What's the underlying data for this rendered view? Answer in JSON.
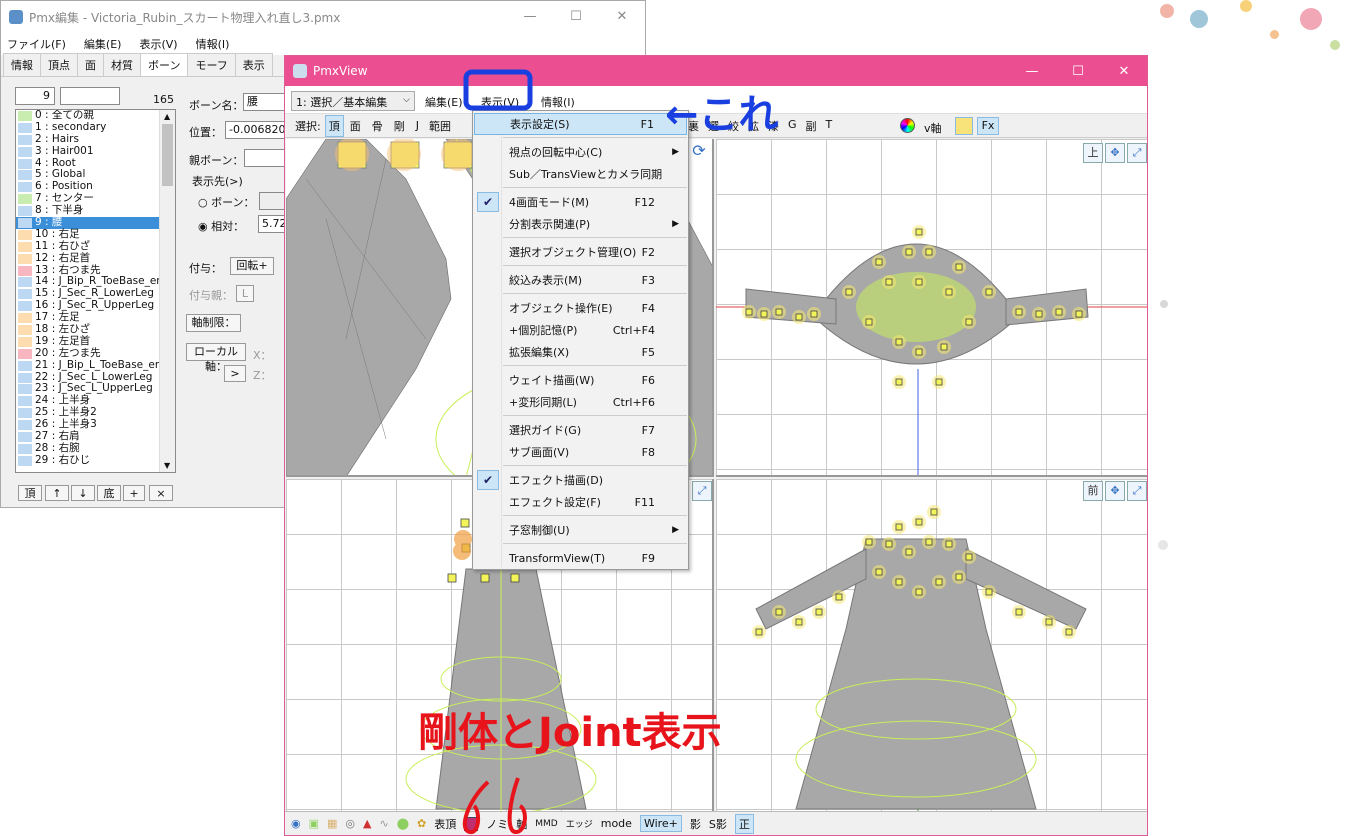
{
  "editor_window": {
    "title": "Pmx編集 - Victoria_Rubin_スカート物理入れ直し3.pmx",
    "menu": [
      "ファイル(F)",
      "編集(E)",
      "表示(V)",
      "情報(I)"
    ],
    "tabs": [
      "情報",
      "頂点",
      "面",
      "材質",
      "ボーン",
      "モーフ",
      "表示"
    ],
    "index_value": "9",
    "count": "165",
    "bone_name_label": "ボーン名：",
    "bone_name_value": "腰",
    "position_label": "位置：",
    "position_value": "-0.006820",
    "parent_label": "親ボーン：",
    "display_to_label": "表示先(>)",
    "radio_bone": "ボーン：",
    "radio_relative": "相対：",
    "relative_value": "5.722",
    "grant_label": "付与：",
    "grant_button": "回転+",
    "grant_parent_label": "付与親：",
    "grant_parent_button": "L",
    "axis_limit_label": "軸制限：",
    "local_axis_label": "ローカル軸：",
    "x_label": "X：",
    "z_label": "Z：",
    "arrow_button": ">",
    "bottom_buttons": [
      "頂",
      "↑",
      "↓",
      "底",
      "+",
      "×"
    ],
    "bones": [
      {
        "text": "0 : 全ての親",
        "color": "#c9ecb1"
      },
      {
        "text": "1 : secondary",
        "color": "#bcd8f2"
      },
      {
        "text": "2 : Hairs",
        "color": "#bcd8f2"
      },
      {
        "text": "3 : Hair001",
        "color": "#bcd8f2"
      },
      {
        "text": "4 : Root",
        "color": "#bcd8f2"
      },
      {
        "text": "5 : Global",
        "color": "#bcd8f2"
      },
      {
        "text": "6 : Position",
        "color": "#bcd8f2"
      },
      {
        "text": "7 : センター",
        "color": "#c9ecb1"
      },
      {
        "text": "8 : 下半身",
        "color": "#bcd8f2"
      },
      {
        "text": "9 : 腰",
        "color": "#bcd8f2"
      },
      {
        "text": "10 : 右足",
        "color": "#fddcb0"
      },
      {
        "text": "11 : 右ひざ",
        "color": "#fddcb0"
      },
      {
        "text": "12 : 右足首",
        "color": "#fddcb0"
      },
      {
        "text": "13 : 右つま先",
        "color": "#f7b6c0"
      },
      {
        "text": "14 : J_Bip_R_ToeBase_en",
        "color": "#bcd8f2"
      },
      {
        "text": "15 : J_Sec_R_LowerLeg",
        "color": "#bcd8f2"
      },
      {
        "text": "16 : J_Sec_R_UpperLeg",
        "color": "#bcd8f2"
      },
      {
        "text": "17 : 左足",
        "color": "#fddcb0"
      },
      {
        "text": "18 : 左ひざ",
        "color": "#fddcb0"
      },
      {
        "text": "19 : 左足首",
        "color": "#fddcb0"
      },
      {
        "text": "20 : 左つま先",
        "color": "#f7b6c0"
      },
      {
        "text": "21 : J_Bip_L_ToeBase_en",
        "color": "#bcd8f2"
      },
      {
        "text": "22 : J_Sec_L_LowerLeg",
        "color": "#bcd8f2"
      },
      {
        "text": "23 : J_Sec_L_UpperLeg",
        "color": "#bcd8f2"
      },
      {
        "text": "24 : 上半身",
        "color": "#bcd8f2"
      },
      {
        "text": "25 : 上半身2",
        "color": "#bcd8f2"
      },
      {
        "text": "26 : 上半身3",
        "color": "#bcd8f2"
      },
      {
        "text": "27 : 右肩",
        "color": "#bcd8f2"
      },
      {
        "text": "28 : 右腕",
        "color": "#bcd8f2"
      },
      {
        "text": "29 : 右ひじ",
        "color": "#bcd8f2"
      }
    ],
    "selected_bone_index": 9
  },
  "pmxview": {
    "title": "PmxView",
    "mode_select": "1: 選択／基本編集",
    "menu": [
      "編集(E)",
      "表示(V)",
      "情報(I)"
    ],
    "toolbar_select_label": "選択:",
    "toolbar_buttons": [
      "頂",
      "面",
      "骨",
      "剛",
      "J",
      "範囲"
    ],
    "toolbar_right": [
      "裏",
      "選",
      "絞",
      "拡",
      "漆",
      "G",
      "副",
      "T"
    ],
    "v_axis_label": "v軸",
    "fx_label": "Fx",
    "view_top_label": "上",
    "view_front_label": "前",
    "status": [
      "表頂",
      "ノミ",
      "軸",
      "MMD",
      "エッジ",
      "mode",
      "Wire+",
      "影",
      "S影",
      "正"
    ]
  },
  "view_menu": {
    "items": [
      {
        "label": "表示設定(S)",
        "shortcut": "F1",
        "highlight": true
      },
      {
        "label": "視点の回転中心(C)",
        "submenu": true
      },
      {
        "label": "Sub／TransViewとカメラ同期"
      },
      {
        "label": "4画面モード(M)",
        "shortcut": "F12",
        "checked": true
      },
      {
        "label": "分割表示関連(P)",
        "submenu": true
      },
      {
        "label": "選択オブジェクト管理(O)",
        "shortcut": "F2"
      },
      {
        "label": "絞込み表示(M)",
        "shortcut": "F3"
      },
      {
        "label": "オブジェクト操作(E)",
        "shortcut": "F4"
      },
      {
        "label": "+個別記憶(P)",
        "shortcut": "Ctrl+F4"
      },
      {
        "label": "拡張編集(X)",
        "shortcut": "F5"
      },
      {
        "label": "ウェイト描画(W)",
        "shortcut": "F6"
      },
      {
        "label": "+変形同期(L)",
        "shortcut": "Ctrl+F6"
      },
      {
        "label": "選択ガイド(G)",
        "shortcut": "F7"
      },
      {
        "label": "サブ画面(V)",
        "shortcut": "F8"
      },
      {
        "label": "エフェクト描画(D)",
        "checked": true
      },
      {
        "label": "エフェクト設定(F)",
        "shortcut": "F11"
      },
      {
        "label": "子窓制御(U)",
        "submenu": true
      },
      {
        "label": "TransformView(T)",
        "shortcut": "F9"
      }
    ]
  },
  "annotations": {
    "kore": "←これ",
    "rigid_joint": "剛体とJoint表示"
  },
  "colors": {
    "pmxview_title": "#ec4f91",
    "annotation_blue": "#1a3fe0",
    "annotation_red": "#e8141c",
    "mesh_gray": "#a8a8a8",
    "rigid_yellow": "#f2ff3a",
    "joint_green": "#b6e84a",
    "bone_orange": "#f0a040"
  }
}
